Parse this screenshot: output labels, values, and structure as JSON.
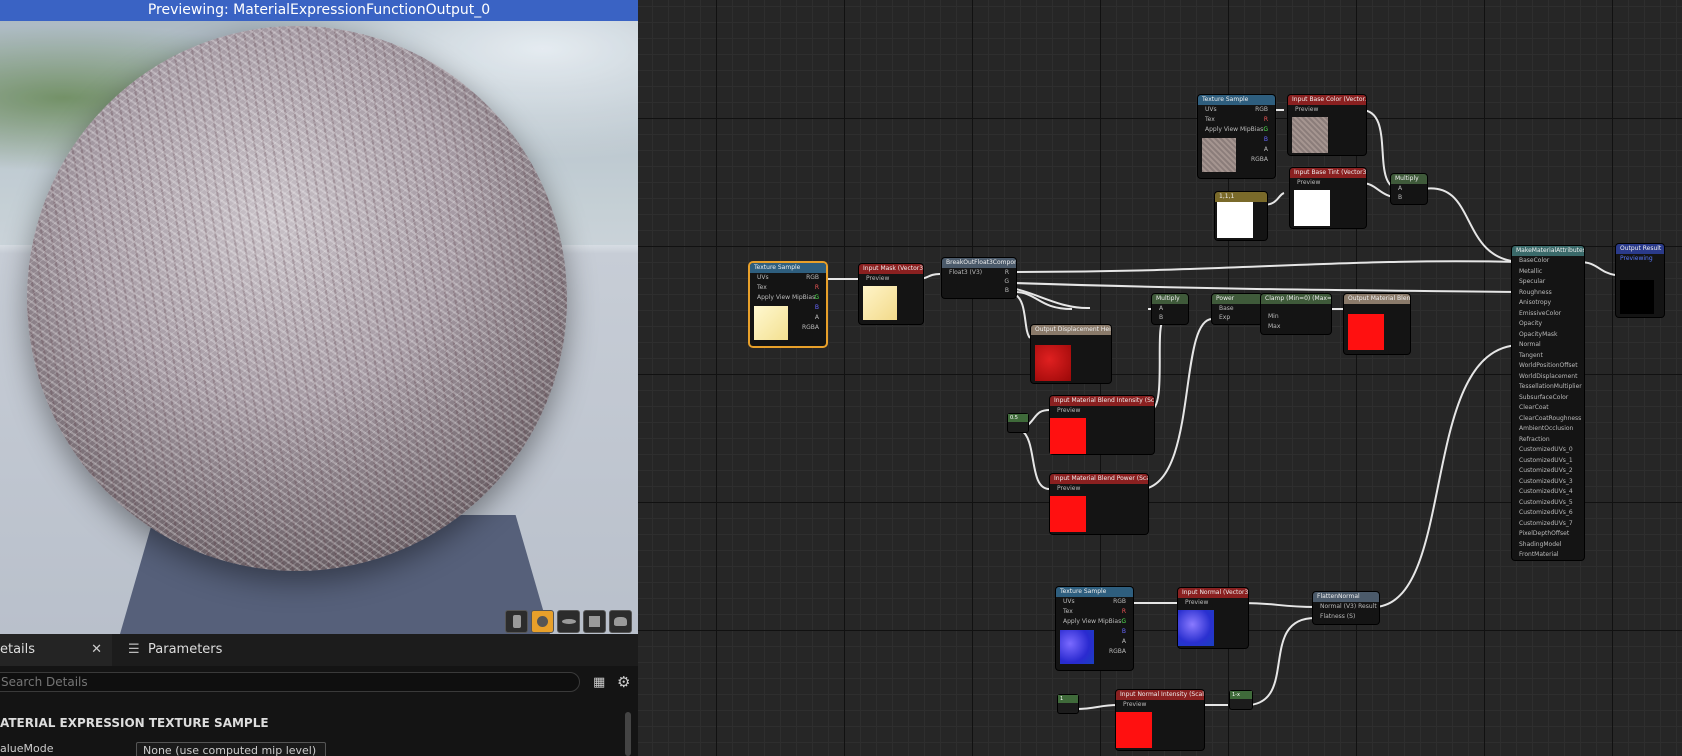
{
  "viewport": {
    "title": "Previewing: MaterialExpressionFunctionOutput_0",
    "view_icons": [
      "cylinder-icon",
      "sphere-icon",
      "plane-icon",
      "cube-icon",
      "teapot-icon"
    ]
  },
  "details": {
    "tab_details_label": "etails",
    "tab_params_label": "Parameters",
    "search_placeholder": "Search Details",
    "section_title": "ATERIAL EXPRESSION TEXTURE SAMPLE",
    "prop_name": "alueMode",
    "prop_value": "None (use computed mip level)"
  },
  "graph": {
    "nodes": {
      "tex1": {
        "title": "Texture Sample",
        "pins": [
          "UVs",
          "Tex",
          "Apply View MipBias"
        ],
        "outs": [
          "RGB",
          "R",
          "G",
          "B",
          "A",
          "RGBA"
        ]
      },
      "mask": {
        "title": "Input Mask (Vector3)",
        "pin": "Preview"
      },
      "break": {
        "title": "BreakOutFloat3Components",
        "pin": "Float3 (V3)",
        "outs": [
          "R",
          "G",
          "B"
        ]
      },
      "disp": {
        "title": "Output Displacement Height"
      },
      "intensity": {
        "title": "Input Material Blend Intensity (Scalar)",
        "pin": "Preview"
      },
      "power_in": {
        "title": "Input Material Blend Power (Scalar)",
        "pin": "Preview"
      },
      "mul1": {
        "title": "Multiply",
        "pins": [
          "A",
          "B"
        ]
      },
      "pow": {
        "title": "Power",
        "pins": [
          "Base",
          "Exp"
        ]
      },
      "clamp": {
        "title": "Clamp (Min=0) (Max=1)",
        "pins": [
          "Min",
          "Max"
        ]
      },
      "blend_out": {
        "title": "Output Material Blend"
      },
      "tex2": {
        "title": "Texture Sample",
        "pins": [
          "UVs",
          "Tex",
          "Apply View MipBias"
        ],
        "outs": [
          "RGB",
          "R",
          "G",
          "B",
          "A",
          "RGBA"
        ]
      },
      "basecolor": {
        "title": "Input Base Color (Vector3)",
        "pin": "Preview"
      },
      "tint": {
        "title": "Input Base Tint (Vector3)",
        "pin": "Preview"
      },
      "const_tint": {
        "title": "1,1,1"
      },
      "mul2": {
        "title": "Multiply",
        "pins": [
          "A",
          "B"
        ]
      },
      "make_attr": {
        "title": "MakeMaterialAttributes",
        "pins": [
          "BaseColor",
          "Metallic",
          "Specular",
          "Roughness",
          "Anisotropy",
          "EmissiveColor",
          "Opacity",
          "OpacityMask",
          "Normal",
          "Tangent",
          "WorldPositionOffset",
          "WorldDisplacement",
          "TessellationMultiplier",
          "SubsurfaceColor",
          "ClearCoat",
          "ClearCoatRoughness",
          "AmbientOcclusion",
          "Refraction",
          "CustomizedUVs_0",
          "CustomizedUVs_1",
          "CustomizedUVs_2",
          "CustomizedUVs_3",
          "CustomizedUVs_4",
          "CustomizedUVs_5",
          "CustomizedUVs_6",
          "CustomizedUVs_7",
          "PixelDepthOffset",
          "ShadingModel",
          "FrontMaterial"
        ]
      },
      "output": {
        "title": "Output Result",
        "pin": "Previewing"
      },
      "tex3": {
        "title": "Texture Sample",
        "pins": [
          "UVs",
          "Tex",
          "Apply View MipBias"
        ],
        "outs": [
          "RGB",
          "R",
          "G",
          "B",
          "A",
          "RGBA"
        ]
      },
      "normal": {
        "title": "Input Normal (Vector3)",
        "pin": "Preview"
      },
      "flatten": {
        "title": "FlattenNormal",
        "pins": [
          "Normal (V3) Result",
          "Flatness (S)"
        ]
      },
      "n_intensity": {
        "title": "Input Normal Intensity (Scalar)",
        "pin": "Preview"
      },
      "c_one": {
        "title": "1"
      },
      "c_half": {
        "title": "0.5"
      },
      "c_sub": {
        "title": "1-x"
      }
    }
  }
}
